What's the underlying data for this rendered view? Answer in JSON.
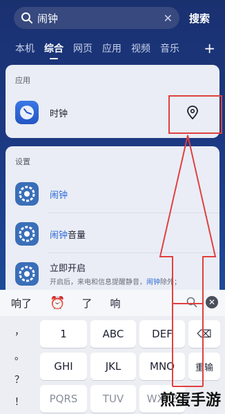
{
  "search": {
    "query": "闹钟",
    "clear": "✕",
    "button": "搜索"
  },
  "tabs": [
    "本机",
    "综合",
    "网页",
    "应用",
    "视频",
    "音乐"
  ],
  "tab_plus": "+",
  "apps_section": {
    "title": "应用",
    "item": {
      "label": "时钟",
      "icon": "clock-icon",
      "action_icon": "location-pin-icon"
    }
  },
  "settings_section": {
    "title": "设置",
    "items": [
      {
        "label_hl": "闹钟",
        "label_rest": "",
        "icon": "settings-gear-icon"
      },
      {
        "label_hl": "闹钟",
        "label_rest": "音量",
        "icon": "settings-gear-icon"
      },
      {
        "label": "立即开启",
        "sub_pre": "开启后，来电和信息提醒静音，",
        "sub_hl": "闹钟",
        "sub_post": "除外；",
        "icon": "settings-gear-icon"
      }
    ]
  },
  "keyboard": {
    "candidates": [
      "响了",
      "⏰",
      "了",
      "响"
    ],
    "punct": [
      "，",
      "。",
      "？",
      "！"
    ],
    "keys_row1": [
      "1",
      "ABC",
      "DEF"
    ],
    "keys_row2": [
      "GHI",
      "JKL",
      "MNO"
    ],
    "keys_row3": [
      "PQRS",
      "TUV",
      "WXYZ"
    ],
    "backspace": "⌫",
    "enter": "重输"
  },
  "watermark": "煎蛋手游",
  "colors": {
    "accent": "#2f6bd7",
    "annotation": "#e04040"
  }
}
